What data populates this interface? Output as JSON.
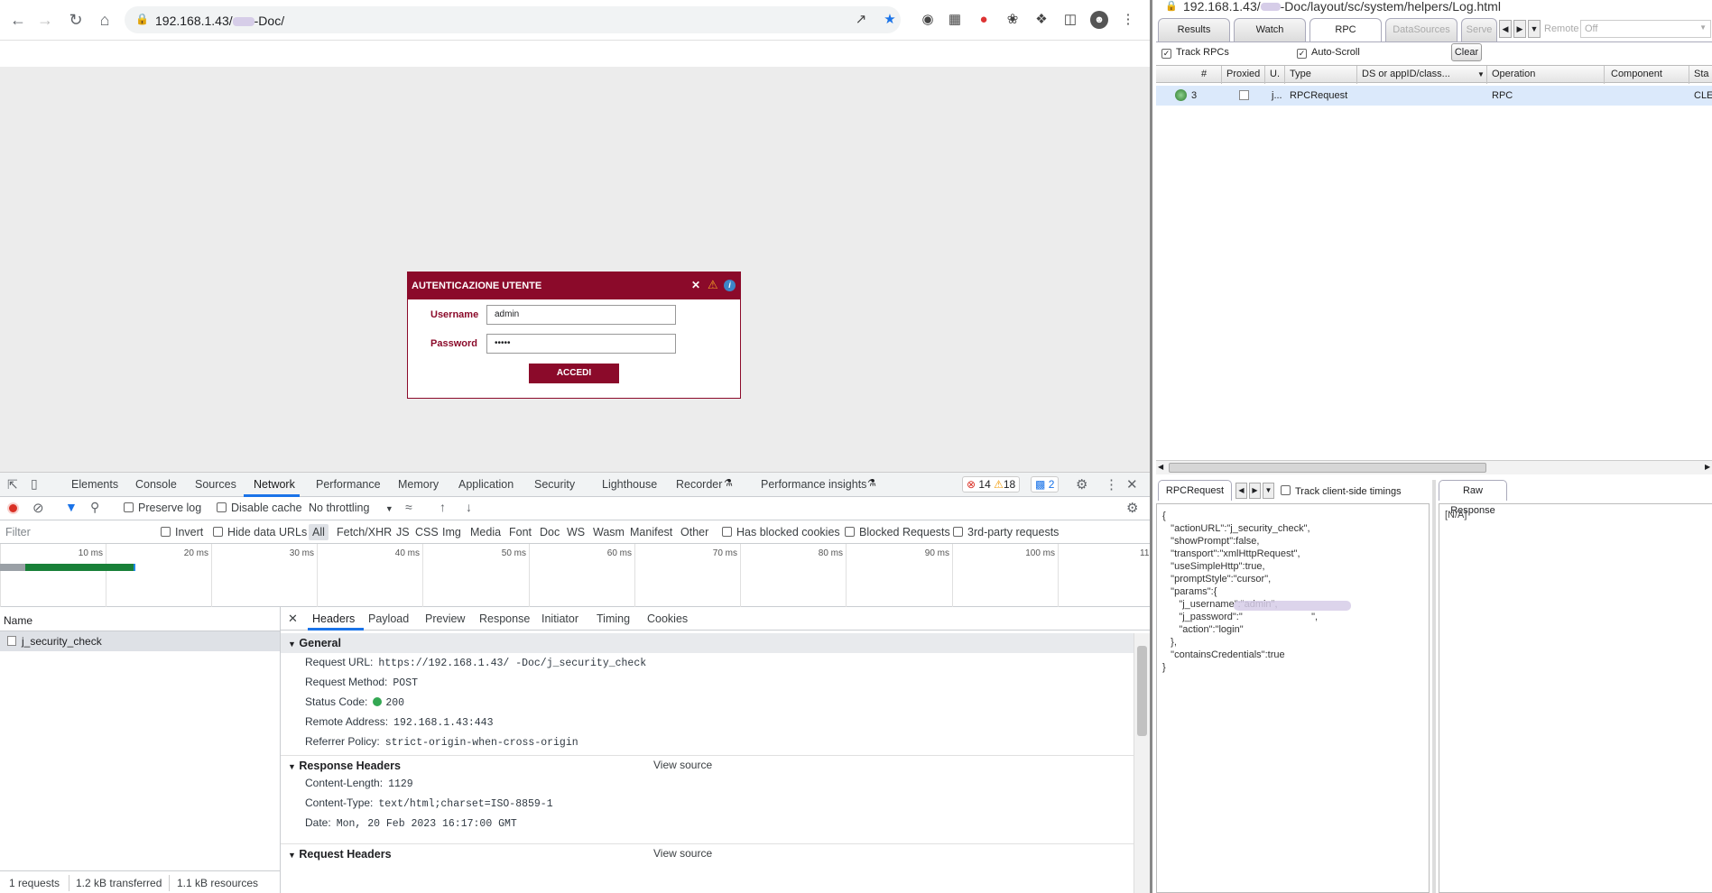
{
  "browser": {
    "url": "192.168.1.43/",
    "url_suffix": "-Doc/"
  },
  "login": {
    "title": "AUTENTICAZIONE UTENTE",
    "username_label": "Username",
    "password_label": "Password",
    "username_value": "admin",
    "password_value": "•••••",
    "submit_label": "ACCEDI"
  },
  "devtools": {
    "tabs": [
      "Elements",
      "Console",
      "Sources",
      "Network",
      "Performance",
      "Memory",
      "Application",
      "Security",
      "Lighthouse",
      "Recorder",
      "Performance insights"
    ],
    "errors": "14",
    "warnings": "18",
    "messages": "2",
    "preserve_log": "Preserve log",
    "disable_cache": "Disable cache",
    "throttling": "No throttling",
    "filter_placeholder": "Filter",
    "invert": "Invert",
    "hide_data_urls": "Hide data URLs",
    "types": [
      "All",
      "Fetch/XHR",
      "JS",
      "CSS",
      "Img",
      "Media",
      "Font",
      "Doc",
      "WS",
      "Wasm",
      "Manifest",
      "Other"
    ],
    "has_blocked_cookies": "Has blocked cookies",
    "blocked_requests": "Blocked Requests",
    "third_party": "3rd-party requests",
    "ticks": [
      "10 ms",
      "20 ms",
      "30 ms",
      "40 ms",
      "50 ms",
      "60 ms",
      "70 ms",
      "80 ms",
      "90 ms",
      "100 ms",
      "11"
    ],
    "name_header": "Name",
    "request_name": "j_security_check",
    "detail_tabs": [
      "Headers",
      "Payload",
      "Preview",
      "Response",
      "Initiator",
      "Timing",
      "Cookies"
    ],
    "general_title": "General",
    "general": [
      {
        "k": "Request URL:",
        "v": "https://192.168.1.43/   -Doc/j_security_check"
      },
      {
        "k": "Request Method:",
        "v": "POST"
      },
      {
        "k": "Status Code:",
        "v": "200"
      },
      {
        "k": "Remote Address:",
        "v": "192.168.1.43:443"
      },
      {
        "k": "Referrer Policy:",
        "v": "strict-origin-when-cross-origin"
      }
    ],
    "response_headers_title": "Response Headers",
    "view_source": "View source",
    "response_headers": [
      {
        "k": "Content-Length:",
        "v": "1129"
      },
      {
        "k": "Content-Type:",
        "v": "text/html;charset=ISO-8859-1"
      },
      {
        "k": "Date:",
        "v": "Mon, 20 Feb 2023 16:17:00 GMT"
      }
    ],
    "request_headers_title": "Request Headers",
    "status": {
      "requests": "1 requests",
      "transferred": "1.2 kB transferred",
      "resources": "1.1 kB resources"
    }
  },
  "devconsole": {
    "title_url": "192.168.1.43/",
    "title_suffix": "-Doc/layout/sc/system/helpers/Log.html",
    "tabs": [
      "Results",
      "Watch",
      "RPC",
      "DataSources",
      "Serve"
    ],
    "remote_label": "Remote",
    "remote_value": "Off",
    "track_rpcs": "Track RPCs",
    "auto_scroll": "Auto-Scroll",
    "clear": "Clear",
    "columns": [
      "#",
      "Proxied",
      "U.",
      "Type",
      "DS or appID/class...",
      "Operation",
      "Component",
      "Sta"
    ],
    "row": {
      "num": "3",
      "u": "j...",
      "type": "RPCRequest",
      "op": "RPC",
      "status": "CLEAR"
    },
    "bottom_tab": "RPCRequest",
    "track_timings": "Track client-side timings",
    "raw_tab": "Raw Response",
    "json_text": "{\n   \"actionURL\":\"j_security_check\",\n   \"showPrompt\":false,\n   \"transport\":\"xmlHttpRequest\",\n   \"useSimpleHttp\":true,\n   \"promptStyle\":\"cursor\",\n   \"params\":{\n      \"j_username\":\"admin\",\n      \"j_password\":\"                         \",\n      \"action\":\"login\"\n   },\n   \"containsCredentials\":true\n}",
    "raw_text": "[N/A]"
  }
}
